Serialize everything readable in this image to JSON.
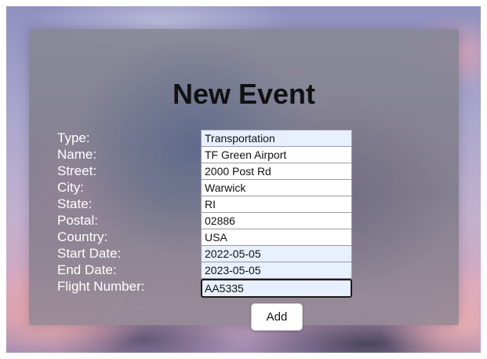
{
  "form": {
    "title": "New Event",
    "fields": [
      {
        "label": "Type:",
        "value": "Transportation",
        "autofill": true
      },
      {
        "label": "Name:",
        "value": "TF Green Airport",
        "autofill": false
      },
      {
        "label": "Street:",
        "value": "2000 Post Rd",
        "autofill": false
      },
      {
        "label": "City:",
        "value": "Warwick",
        "autofill": false
      },
      {
        "label": "State:",
        "value": "RI",
        "autofill": false
      },
      {
        "label": "Postal:",
        "value": "02886",
        "autofill": false
      },
      {
        "label": "Country:",
        "value": "USA",
        "autofill": false
      },
      {
        "label": "Start Date:",
        "value": "2022-05-05",
        "autofill": true
      },
      {
        "label": "End Date:",
        "value": "2023-05-05",
        "autofill": true
      },
      {
        "label": "Flight Number:",
        "value": "AA5335",
        "autofill": true
      }
    ],
    "add_label": "Add"
  },
  "colors": {
    "label_text": "#ffffff",
    "title_text": "#111111",
    "autofill_bg": "#e8f0fe",
    "focus_border": "#1b1b1b"
  }
}
